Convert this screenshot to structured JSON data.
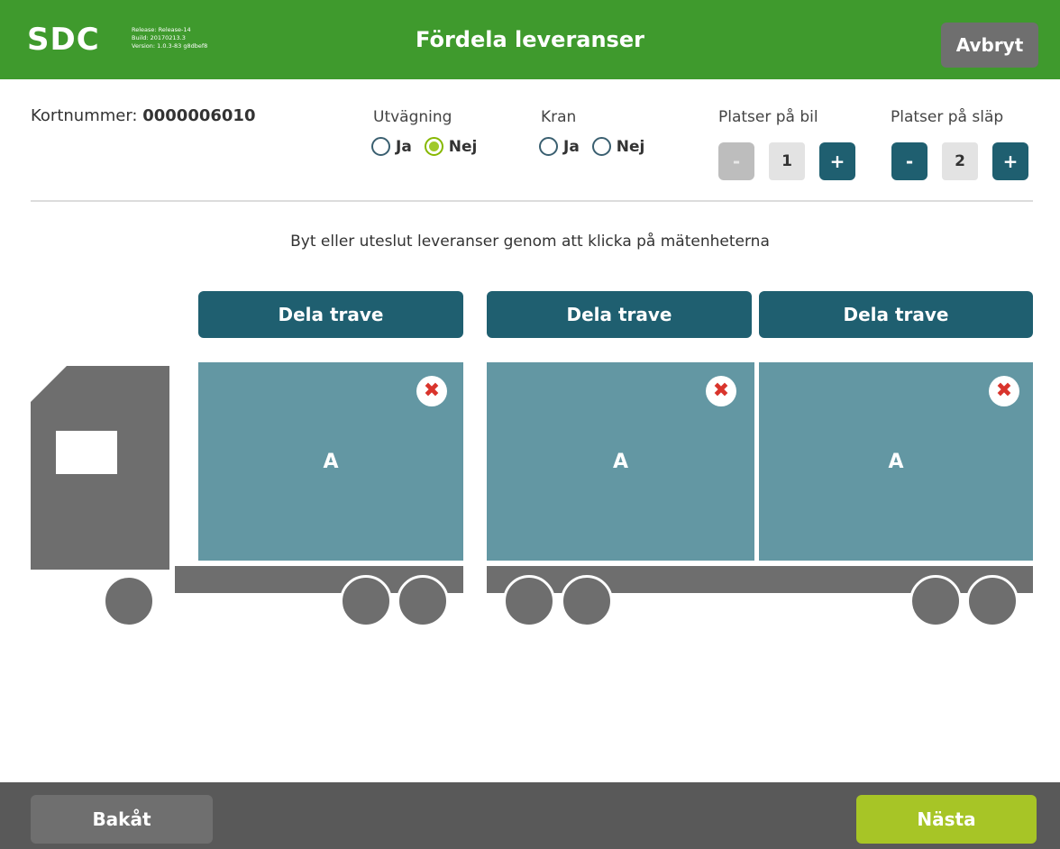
{
  "header": {
    "logo_text": "SDC",
    "build_info": [
      "Release: Release-14",
      "Build: 20170213.3",
      "Version: 1.0.3-83 g8dbef8"
    ],
    "title": "Fördela leveranser",
    "cancel_label": "Avbryt"
  },
  "info": {
    "card_label": "Kortnummer: ",
    "card_number": "0000006010",
    "weighing": {
      "label": "Utvägning",
      "options": [
        "Ja",
        "Nej"
      ],
      "selected": "Nej"
    },
    "crane": {
      "label": "Kran",
      "options": [
        "Ja",
        "Nej"
      ],
      "selected": null
    },
    "truck_slots": {
      "label": "Platser på bil",
      "minus": "-",
      "value": "1",
      "plus": "+"
    },
    "trailer_slots": {
      "label": "Platser på släp",
      "minus": "-",
      "value": "2",
      "plus": "+"
    }
  },
  "instruction": "Byt eller uteslut leveranser genom att klicka på mätenheterna",
  "slots": [
    {
      "split_label": "Dela trave",
      "unit": "A",
      "remove_icon": "close-icon"
    },
    {
      "split_label": "Dela trave",
      "unit": "A",
      "remove_icon": "close-icon"
    },
    {
      "split_label": "Dela trave",
      "unit": "A",
      "remove_icon": "close-icon"
    }
  ],
  "footer": {
    "back_label": "Bakåt",
    "next_label": "Nästa"
  },
  "colors": {
    "header_green": "#3f9a2d",
    "accent_teal": "#1f5f70",
    "slot_teal": "#6397a3",
    "next_green": "#a7c526",
    "truck_gray": "#6e6e6e",
    "remove_red": "#d9342c"
  }
}
